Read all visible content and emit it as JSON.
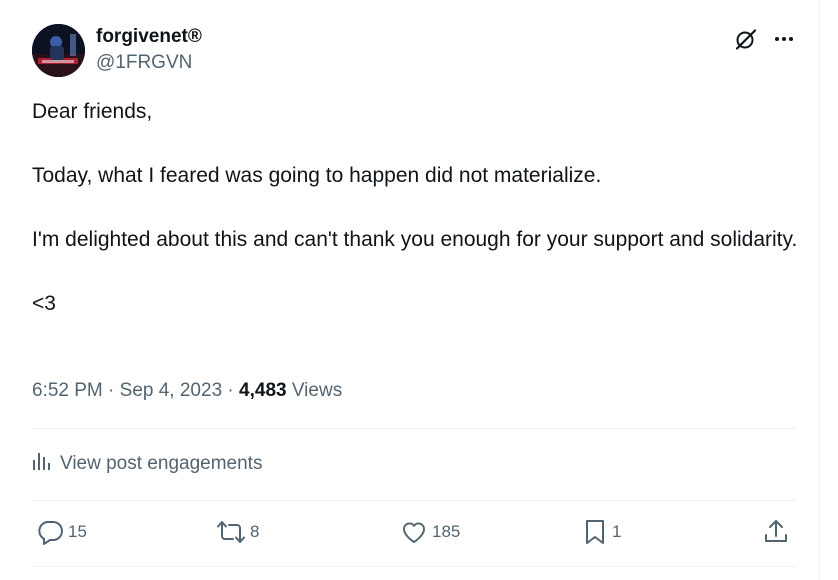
{
  "tweet": {
    "author": {
      "display_name": "forgivenet®",
      "handle": "@1FRGVN",
      "avatar_icon": "avatar"
    },
    "text": {
      "line1": "Dear friends,",
      "line2": "Today, what I feared was going to happen did not materialize.",
      "line3": "I'm delighted about this and can't thank you enough for your support and solidarity.",
      "line4": "<3"
    },
    "meta": {
      "time": "6:52 PM",
      "sep1": " · ",
      "date": "Sep 4, 2023",
      "sep2": " · ",
      "views_count": "4,483",
      "views_label": " Views"
    },
    "engagements_label": "View post engagements",
    "actions": {
      "reply_count": "15",
      "repost_count": "8",
      "like_count": "185",
      "bookmark_count": "1"
    },
    "icons": {
      "grok": "grok-icon",
      "more": "more-icon",
      "analytics": "analytics-icon",
      "reply": "reply-icon",
      "repost": "repost-icon",
      "like": "heart-icon",
      "bookmark": "bookmark-icon",
      "share": "share-icon"
    },
    "colors": {
      "text_primary": "#0f1419",
      "text_secondary": "#536471",
      "divider": "#eff3f4"
    }
  }
}
